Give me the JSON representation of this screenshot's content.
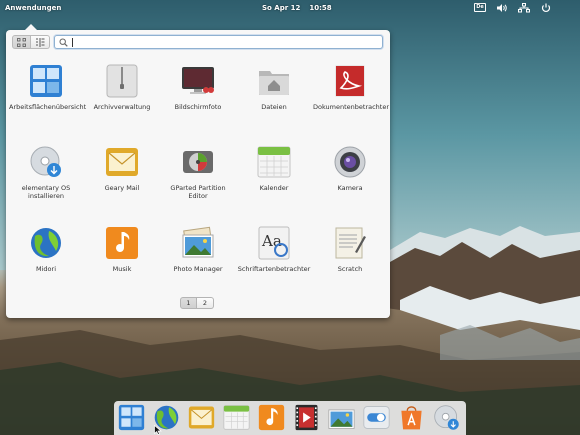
{
  "panel": {
    "applications_label": "Anwendungen",
    "date": "So Apr 12",
    "time": "10:58",
    "keyboard_layout": "De"
  },
  "launcher": {
    "search": {
      "value": "",
      "placeholder": ""
    },
    "apps": [
      {
        "label": "Arbeitsflächenübersicht",
        "icon": "workspace-overview-icon"
      },
      {
        "label": "Archivverwaltung",
        "icon": "archive-manager-icon"
      },
      {
        "label": "Bildschirmfoto",
        "icon": "screenshot-icon"
      },
      {
        "label": "Dateien",
        "icon": "files-folder-icon"
      },
      {
        "label": "Dokumentenbetrachter",
        "icon": "document-viewer-icon"
      },
      {
        "label": "elementary OS installieren",
        "icon": "installer-disc-icon"
      },
      {
        "label": "Geary Mail",
        "icon": "mail-icon"
      },
      {
        "label": "GParted Partition Editor",
        "icon": "gparted-icon"
      },
      {
        "label": "Kalender",
        "icon": "calendar-icon"
      },
      {
        "label": "Kamera",
        "icon": "camera-icon"
      },
      {
        "label": "Midori",
        "icon": "midori-globe-icon"
      },
      {
        "label": "Musik",
        "icon": "music-note-icon"
      },
      {
        "label": "Photo Manager",
        "icon": "photo-manager-icon"
      },
      {
        "label": "Schriftartenbetrachter",
        "icon": "font-viewer-icon"
      },
      {
        "label": "Scratch",
        "icon": "scratch-editor-icon"
      }
    ],
    "pages": [
      "1",
      "2"
    ],
    "current_page": "1"
  },
  "dock": {
    "items": [
      "workspace-overview-icon",
      "midori-globe-icon",
      "mail-icon",
      "calendar-icon",
      "music-note-icon",
      "video-player-icon",
      "photo-manager-icon",
      "settings-toggle-icon",
      "app-center-icon",
      "installer-disc-icon"
    ]
  }
}
